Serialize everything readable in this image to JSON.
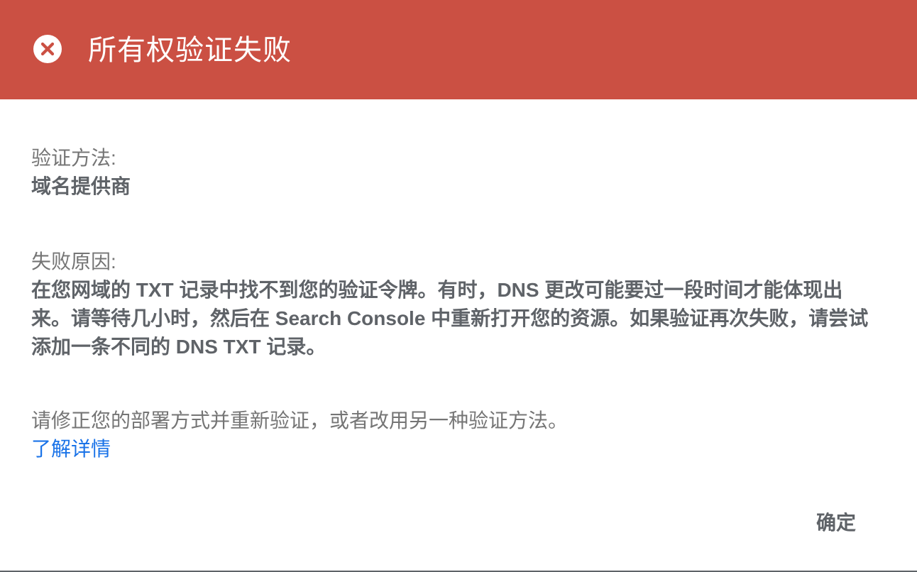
{
  "dialog": {
    "title": "所有权验证失败",
    "header_color": "#cb5043",
    "header_icon": "error-circle-x-icon"
  },
  "method": {
    "label": "验证方法:",
    "value": "域名提供商"
  },
  "reason": {
    "label": "失败原因:",
    "value": "在您网域的 TXT 记录中找不到您的验证令牌。有时，DNS 更改可能要过一段时间才能体现出来。请等待几小时，然后在 Search Console 中重新打开您的资源。如果验证再次失败，请尝试添加一条不同的 DNS TXT 记录。"
  },
  "fix": {
    "text": "请修正您的部署方式并重新验证，或者改用另一种验证方法。",
    "link_label": "了解详情",
    "link_color": "#1a73e8"
  },
  "actions": {
    "ok_label": "确定"
  }
}
